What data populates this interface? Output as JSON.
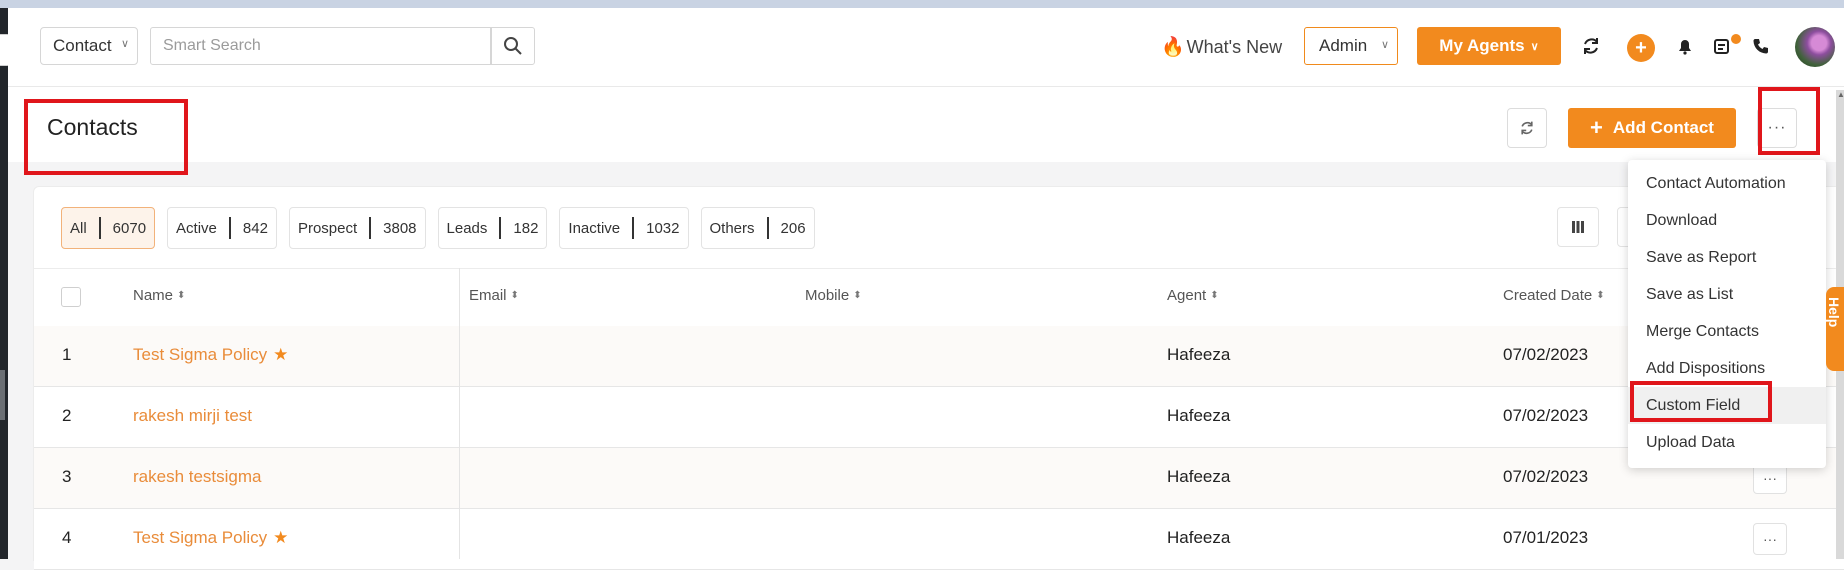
{
  "header": {
    "module": "Contact",
    "search_placeholder": "Smart Search",
    "whats_new": "What's New",
    "role": "Admin",
    "agents_label": "My Agents",
    "plus": "+"
  },
  "page": {
    "title": "Contacts",
    "add_contact": "Add Contact",
    "more": "···"
  },
  "filters": [
    {
      "label": "All",
      "count": "6070"
    },
    {
      "label": "Active",
      "count": "842"
    },
    {
      "label": "Prospect",
      "count": "3808"
    },
    {
      "label": "Leads",
      "count": "182"
    },
    {
      "label": "Inactive",
      "count": "1032"
    },
    {
      "label": "Others",
      "count": "206"
    }
  ],
  "table": {
    "headers": {
      "name": "Name",
      "email": "Email",
      "mobile": "Mobile",
      "agent": "Agent",
      "created": "Created Date"
    },
    "rows": [
      {
        "num": "1",
        "name": "Test Sigma Policy",
        "agent": "Hafeeza",
        "created": "07/02/2023"
      },
      {
        "num": "2",
        "name": "rakesh mirji test",
        "agent": "Hafeeza",
        "created": "07/02/2023"
      },
      {
        "num": "3",
        "name": "rakesh testsigma",
        "agent": "Hafeeza",
        "created": "07/02/2023"
      },
      {
        "num": "4",
        "name": "Test Sigma Policy",
        "agent": "Hafeeza",
        "created": "07/01/2023"
      }
    ],
    "row_more": "···"
  },
  "menu": {
    "items": [
      "Contact Automation",
      "Download",
      "Save as Report",
      "Save as List",
      "Merge Contacts",
      "Add Dispositions",
      "Custom Field",
      "Upload Data"
    ]
  },
  "help": "Help",
  "colors": {
    "accent": "#f28a1e",
    "highlight_box": "#e0161b"
  }
}
